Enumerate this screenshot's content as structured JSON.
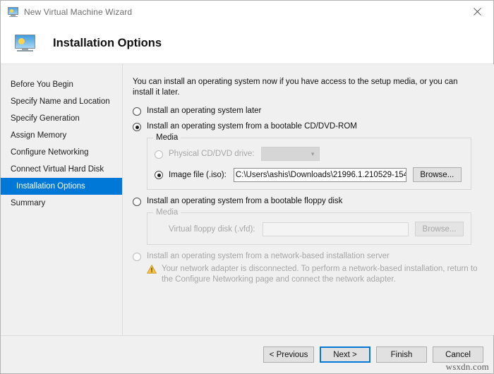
{
  "window": {
    "title": "New Virtual Machine Wizard",
    "icon": "virtual-machine-icon",
    "close_label": "×"
  },
  "header": {
    "title": "Installation Options",
    "icon": "virtual-machine-icon"
  },
  "sidebar": {
    "items": [
      {
        "label": "Before You Begin",
        "selected": false
      },
      {
        "label": "Specify Name and Location",
        "selected": false
      },
      {
        "label": "Specify Generation",
        "selected": false
      },
      {
        "label": "Assign Memory",
        "selected": false
      },
      {
        "label": "Configure Networking",
        "selected": false
      },
      {
        "label": "Connect Virtual Hard Disk",
        "selected": false
      },
      {
        "label": "Installation Options",
        "selected": true
      },
      {
        "label": "Summary",
        "selected": false
      }
    ],
    "selected_color": "#0078d7"
  },
  "main": {
    "intro": "You can install an operating system now if you have access to the setup media, or you can install it later.",
    "options": [
      {
        "id": "later",
        "label": "Install an operating system later",
        "checked": false,
        "enabled": true
      },
      {
        "id": "cddvd",
        "label": "Install an operating system from a bootable CD/DVD-ROM",
        "checked": true,
        "enabled": true
      },
      {
        "id": "floppy",
        "label": "Install an operating system from a bootable floppy disk",
        "checked": false,
        "enabled": true
      },
      {
        "id": "network",
        "label": "Install an operating system from a network-based installation server",
        "checked": false,
        "enabled": false
      }
    ],
    "cddvd_group": {
      "legend": "Media",
      "physical_drive": {
        "label": "Physical CD/DVD drive:",
        "checked": false,
        "enabled": false,
        "combo_value": "",
        "combo_caret": "∨"
      },
      "image_file": {
        "label": "Image file (.iso):",
        "checked": true,
        "enabled": true,
        "value": "C:\\Users\\ashis\\Downloads\\21996.1.210529-154:",
        "placeholder": "",
        "browse_label": "Browse..."
      }
    },
    "floppy_group": {
      "legend": "Media",
      "vfd": {
        "label": "Virtual floppy disk (.vfd):",
        "value": "",
        "placeholder": "",
        "browse_label": "Browse...",
        "enabled": false
      }
    },
    "network_warning": {
      "icon": "warning-triangle-icon",
      "text": "Your network adapter is disconnected. To perform a network-based installation, return to the Configure Networking page and connect the network adapter."
    }
  },
  "footer": {
    "buttons": [
      {
        "label": "< Previous",
        "default": false
      },
      {
        "label": "Next >",
        "default": true
      },
      {
        "label": "Finish",
        "default": false
      },
      {
        "label": "Cancel",
        "default": false
      }
    ]
  },
  "watermark": {
    "text": "wsxdn.com"
  }
}
